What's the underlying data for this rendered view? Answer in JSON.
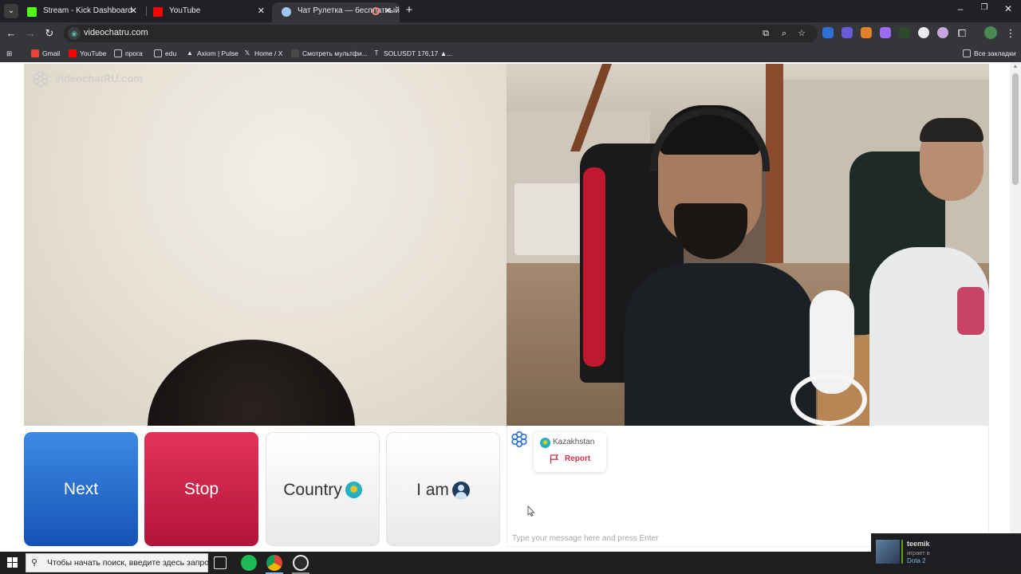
{
  "browser": {
    "tabs": [
      {
        "title": "Stream - Kick Dashboard",
        "active": false,
        "favicon_color": "#53fc18"
      },
      {
        "title": "YouTube",
        "active": false,
        "favicon_color": "#ff0000"
      },
      {
        "title": "Чат Рулетка — бесплатный",
        "active": true,
        "favicon_color": "#9ec5f5",
        "recording_indicator": true
      }
    ],
    "address": "videochatru.com",
    "bookmarks": [
      {
        "label": "Gmail"
      },
      {
        "label": "YouTube"
      },
      {
        "label": "прога"
      },
      {
        "label": "edu"
      },
      {
        "label": "Axiom | Pulse"
      },
      {
        "label": "Home / X"
      },
      {
        "label": "Смотреть мультфи..."
      },
      {
        "label": "SOLUSDT 176,17 ▲..."
      }
    ],
    "all_bookmarks_label": "Все закладки"
  },
  "page": {
    "watermark": "VideochatRU.com",
    "buttons": {
      "next": "Next",
      "stop": "Stop",
      "country": "Country",
      "iam": "I am"
    },
    "partner": {
      "country": "Kazakhstan",
      "report_label": "Report"
    },
    "chat": {
      "placeholder": "Type your message here and press Enter"
    },
    "colors": {
      "next": "#2a70d1",
      "stop": "#cf2148",
      "report": "#d6304d"
    }
  },
  "taskbar": {
    "search_placeholder": "Чтобы начать поиск, введите здесь запрос"
  },
  "notification": {
    "user": "teemik",
    "status": "играет в",
    "game": "Dota 2"
  }
}
